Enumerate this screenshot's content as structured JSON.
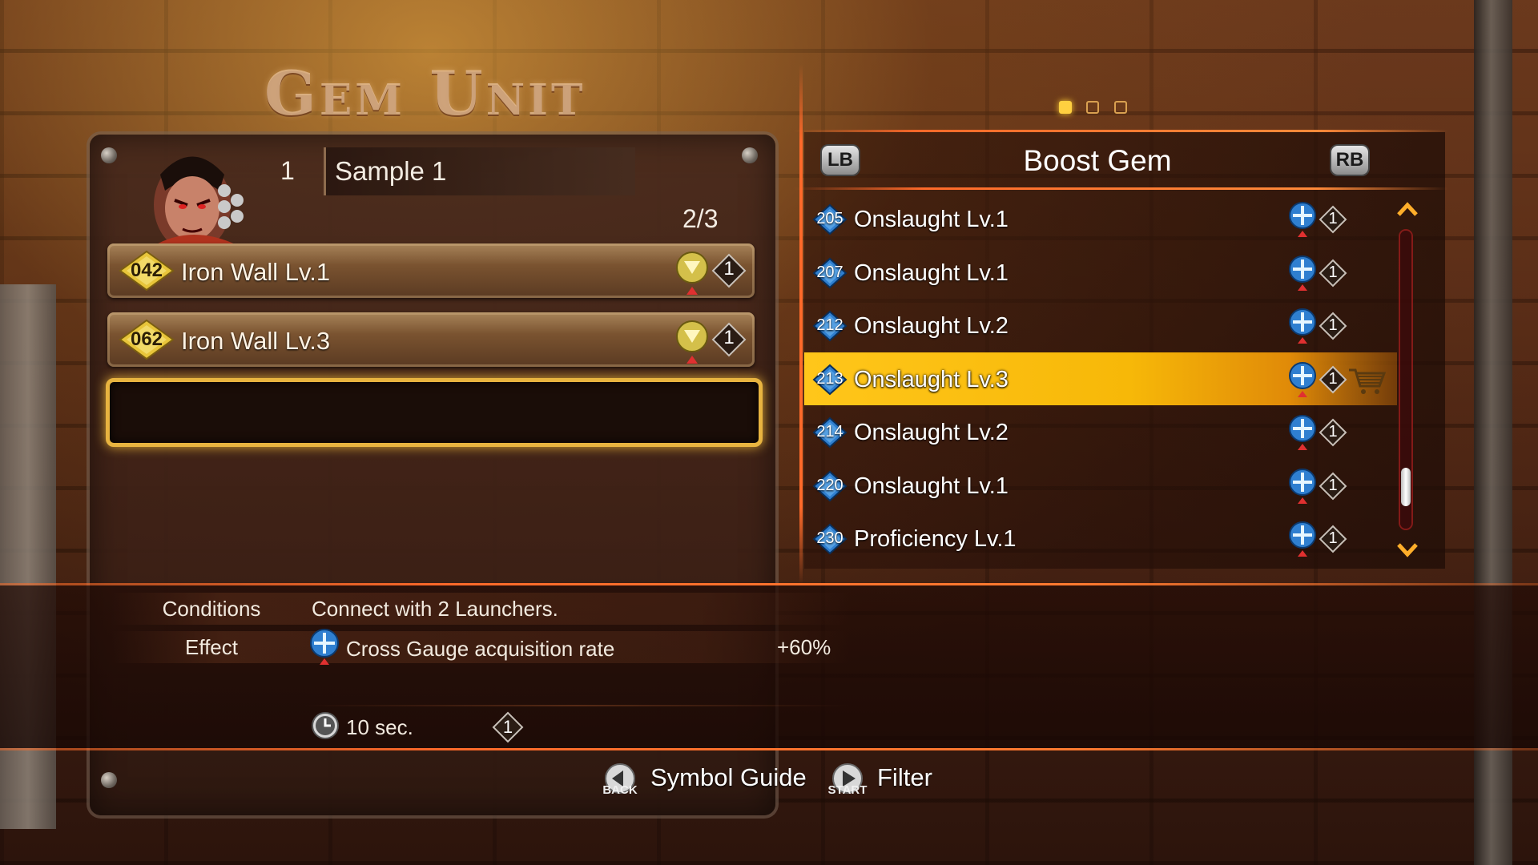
{
  "screen": {
    "title": "Gem Unit",
    "page_indicator": {
      "current": 1,
      "total": 3
    }
  },
  "unit": {
    "number": "1",
    "name": "Sample 1",
    "slot_count": "2/3",
    "slots": [
      {
        "id": "042",
        "name": "Iron Wall Lv.1",
        "cost": "1"
      },
      {
        "id": "062",
        "name": "Iron Wall Lv.3",
        "cost": "1"
      }
    ]
  },
  "gem_list": {
    "lb_label": "LB",
    "rb_label": "RB",
    "title": "Boost Gem",
    "selected_index": 3,
    "items": [
      {
        "id": "205",
        "name": "Onslaught Lv.1",
        "cost": "1"
      },
      {
        "id": "207",
        "name": "Onslaught Lv.1",
        "cost": "1"
      },
      {
        "id": "212",
        "name": "Onslaught Lv.2",
        "cost": "1"
      },
      {
        "id": "213",
        "name": "Onslaught Lv.3",
        "cost": "1"
      },
      {
        "id": "214",
        "name": "Onslaught Lv.2",
        "cost": "1"
      },
      {
        "id": "220",
        "name": "Onslaught Lv.1",
        "cost": "1"
      },
      {
        "id": "230",
        "name": "Proficiency Lv.1",
        "cost": "1"
      }
    ]
  },
  "details": {
    "conditions_label": "Conditions",
    "conditions_text": "Connect with 2 Launchers.",
    "effect_label": "Effect",
    "effect_text": "Cross Gauge acquisition rate",
    "effect_value": "+60%",
    "duration": "10 sec.",
    "cost": "1"
  },
  "footer": {
    "back_caption": "BACK",
    "back_label": "Symbol Guide",
    "start_caption": "START",
    "start_label": "Filter"
  },
  "colors": {
    "highlight": "#ffc61a",
    "accent_line": "#ff6a2a",
    "slot_gem": "#e8c53a",
    "boost_gem": "#2f7fd0"
  },
  "icons": {
    "slot_gem": "yellow-diamond-gem-icon",
    "slot_type": "shield-crest-icon",
    "list_gem": "blue-diamond-gem-icon",
    "list_type": "cross-gauge-icon",
    "cost": "diamond-cost-icon",
    "purchase": "shopping-cart-icon",
    "timer": "clock-icon"
  }
}
